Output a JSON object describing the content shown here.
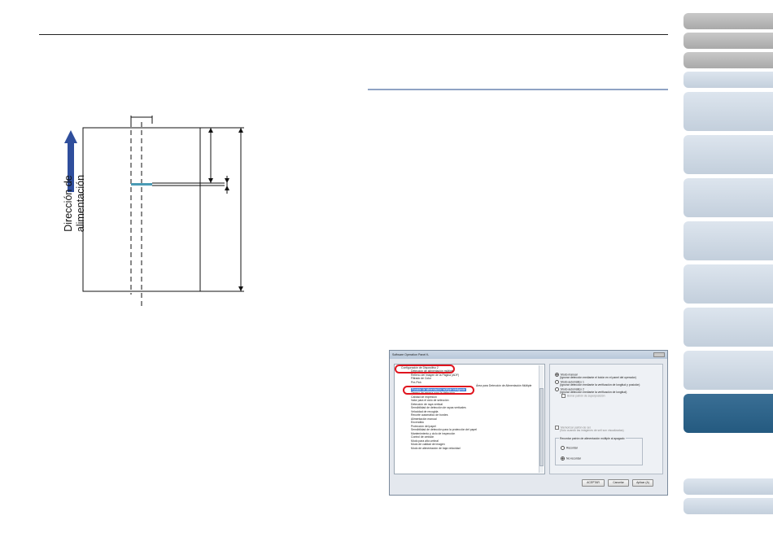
{
  "diagram": {
    "feed_direction_label_line1": "Dirección de",
    "feed_direction_label_line2": "alimentación",
    "arrow_color": "#2f4e9c",
    "band_color": "#4a9bb5"
  },
  "nav_tabs": {
    "count": 12,
    "active_index": 9,
    "colors": {
      "gray": "#b5b5b5",
      "light": "#cfd9e4",
      "active": "#2b5f85"
    }
  },
  "dialog": {
    "title": "Software Operation Panel fi-",
    "tree_items": [
      "Configuración de Dispositivo 2",
      "Detección de alimentación múltiple",
      "Relleno del Imagen de la Página (ADF)",
      "Filtrado de Color",
      "Pre-Pick",
      "Área para Detección de Alimentación Múltiple",
      "Función de alimentación múltiple inteligente",
      "Tiempo de espera para la detección",
      "Calidad de impresión",
      "Valor para el ciclo de selección",
      "Detección de raya vertical",
      "Sensibilidad de detección de rayas verticales",
      "Velocidad de recogida",
      "Recorte automático de bordes",
      "Alimentación manual",
      "Encendido",
      "Protección del papel",
      "Sensibilidad de detección para la protección del papel",
      "Mantenimiento y ciclo de inspección",
      "Control de omisión",
      "Modo para alto umbral",
      "Modo de calidad de imagen",
      "Modo de alimentación de baja velocidad"
    ],
    "selected_item": "Función de alimentación múltiple inteligente",
    "options": [
      {
        "label": "Modo manual",
        "note": "(Ignorar detección mediante el botón en el panel del operador)",
        "checked": true
      },
      {
        "label": "Modo automático 1",
        "note": "(Ignorar detección mediante la verificación de longitud y posición)",
        "checked": false
      },
      {
        "label": "Modo automático 2",
        "note": "(Ignorar detección mediante la verificación de longitud)",
        "checked": false
      }
    ],
    "sub_checkbox": "Borrar patrón de superposición",
    "checkbox_label": "Memorizar patrón de sel.",
    "checkbox_note": "(Solo cuando las imágenes de sell son visualizadas)",
    "group_title": "Recordar patrón de alimentación múltiple al apagado",
    "group_options": [
      {
        "label": "Recordar",
        "checked": false
      },
      {
        "label": "No recordar",
        "checked": true
      }
    ],
    "buttons": {
      "ok": "ACEPTAR",
      "cancel": "Cancelar",
      "apply": "Aplicar (A)"
    }
  }
}
